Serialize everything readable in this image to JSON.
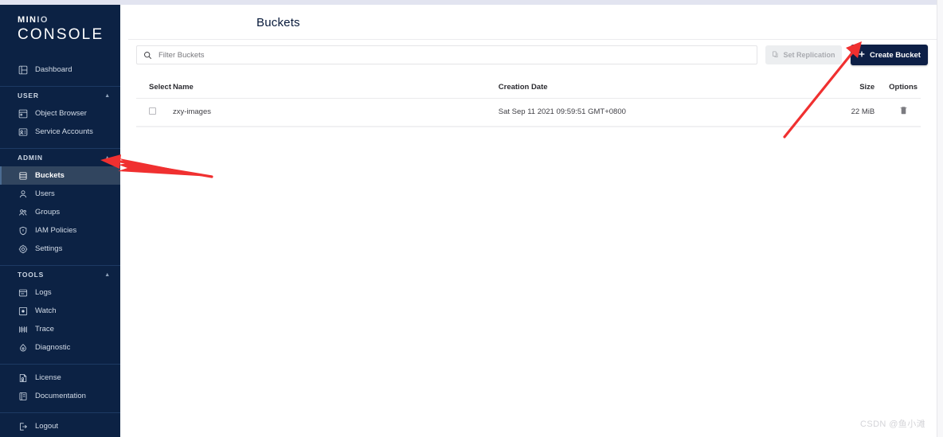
{
  "brand": {
    "name_top": "MIN",
    "name_top_accent": "IO",
    "name_bottom": "CONSOLE"
  },
  "sidebar": {
    "dashboard": {
      "label": "Dashboard",
      "icon": "dashboard-icon"
    },
    "groups": [
      {
        "title": "USER",
        "collapse_icon": "chevron-up-icon",
        "items": [
          {
            "label": "Object Browser",
            "icon": "object-browser-icon",
            "active": false
          },
          {
            "label": "Service Accounts",
            "icon": "service-accounts-icon",
            "active": false
          }
        ]
      },
      {
        "title": "ADMIN",
        "collapse_icon": "chevron-up-icon",
        "items": [
          {
            "label": "Buckets",
            "icon": "bucket-icon",
            "active": true
          },
          {
            "label": "Users",
            "icon": "user-icon",
            "active": false
          },
          {
            "label": "Groups",
            "icon": "groups-icon",
            "active": false
          },
          {
            "label": "IAM Policies",
            "icon": "shield-icon",
            "active": false
          },
          {
            "label": "Settings",
            "icon": "gear-icon",
            "active": false
          }
        ]
      },
      {
        "title": "TOOLS",
        "collapse_icon": "chevron-up-icon",
        "items": [
          {
            "label": "Logs",
            "icon": "logs-icon",
            "active": false
          },
          {
            "label": "Watch",
            "icon": "watch-icon",
            "active": false
          },
          {
            "label": "Trace",
            "icon": "trace-icon",
            "active": false
          },
          {
            "label": "Diagnostic",
            "icon": "diagnostic-icon",
            "active": false
          }
        ]
      }
    ],
    "footer_items": [
      {
        "label": "License",
        "icon": "license-icon"
      },
      {
        "label": "Documentation",
        "icon": "documentation-icon"
      }
    ],
    "logout": {
      "label": "Logout",
      "icon": "logout-icon"
    }
  },
  "header": {
    "title": "Buckets"
  },
  "toolbar": {
    "search_placeholder": "Filter Buckets",
    "search_value": "",
    "search_icon": "search-icon",
    "set_replication_label": "Set Replication",
    "set_replication_icon": "replication-icon",
    "create_bucket_label": "Create Bucket",
    "create_bucket_icon": "plus-icon"
  },
  "table": {
    "columns": [
      "Select",
      "Name",
      "Creation Date",
      "Size",
      "Options"
    ],
    "rows": [
      {
        "selected": false,
        "name": "zxy-images",
        "creation_date": "Sat Sep 11 2021 09:59:51 GMT+0800",
        "size": "22 MiB",
        "options_icon": "trash-icon"
      }
    ]
  },
  "watermark": {
    "text": "CSDN @鱼小滩"
  },
  "colors": {
    "sidebar_bg": "#0c2244",
    "sidebar_active": "#31455f",
    "primary_button": "#0d1f46",
    "annotation_arrow": "#f03030",
    "disabled_button": "#eceef0"
  }
}
